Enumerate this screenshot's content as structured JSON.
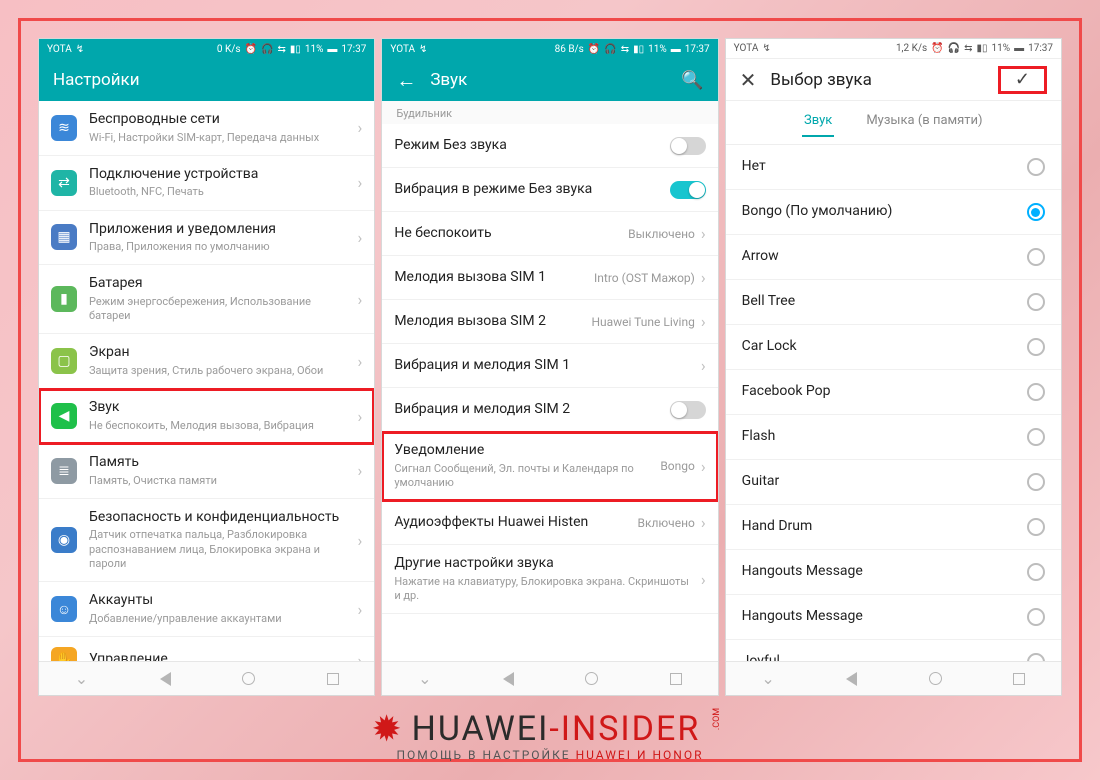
{
  "status": {
    "carrier": "YOTA",
    "p1_speed": "0 K/s",
    "p2_speed": "86 B/s",
    "p3_speed": "1,2 K/s",
    "battery": "11%",
    "time": "17:37"
  },
  "p1": {
    "title": "Настройки",
    "items": [
      {
        "icon": "blue",
        "glyph": "≋",
        "title": "Беспроводные сети",
        "sub": "Wi-Fi, Настройки SIM-карт, Передача данных"
      },
      {
        "icon": "teal",
        "glyph": "⇄",
        "title": "Подключение устройства",
        "sub": "Bluetooth, NFC, Печать"
      },
      {
        "icon": "slate",
        "glyph": "▦",
        "title": "Приложения и уведомления",
        "sub": "Права, Приложения по умолчанию"
      },
      {
        "icon": "green",
        "glyph": "▮",
        "title": "Батарея",
        "sub": "Режим энергосбережения, Использование батареи"
      },
      {
        "icon": "lime",
        "glyph": "▢",
        "title": "Экран",
        "sub": "Защита зрения, Стиль рабочего экрана, Обои"
      },
      {
        "icon": "sound",
        "glyph": "◀︎",
        "title": "Звук",
        "sub": "Не беспокоить, Мелодия вызова, Вибрация",
        "hl": true
      },
      {
        "icon": "gray",
        "glyph": "≣",
        "title": "Память",
        "sub": "Память, Очистка памяти"
      },
      {
        "icon": "shield",
        "glyph": "◉",
        "title": "Безопасность и конфиденциальность",
        "sub": "Датчик отпечатка пальца, Разблокировка распознаванием лица, Блокировка экрана и пароли"
      },
      {
        "icon": "acct",
        "glyph": "☺",
        "title": "Аккаунты",
        "sub": "Добавление/управление аккаунтами"
      },
      {
        "icon": "orange",
        "glyph": "✋",
        "title": "Управление",
        "sub": ""
      }
    ]
  },
  "p2": {
    "title": "Звук",
    "section": "Будильник",
    "items": [
      {
        "title": "Режим Без звука",
        "type": "toggle",
        "on": false
      },
      {
        "title": "Вибрация в режиме Без звука",
        "type": "toggle",
        "on": true
      },
      {
        "title": "Не беспокоить",
        "type": "value",
        "val": "Выключено"
      },
      {
        "title": "Мелодия вызова SIM 1",
        "type": "value",
        "val": "Intro (OST Мажор)"
      },
      {
        "title": "Мелодия вызова SIM 2",
        "type": "value",
        "val": "Huawei Tune Living"
      },
      {
        "title": "Вибрация и мелодия SIM 1",
        "type": "chev"
      },
      {
        "title": "Вибрация и мелодия SIM 2",
        "type": "toggle",
        "on": false
      },
      {
        "title": "Уведомление",
        "sub": "Сигнал Сообщений, Эл. почты и Календаря по умолчанию",
        "type": "value",
        "val": "Bongo",
        "hl": true
      },
      {
        "title": "Аудиоэффекты Huawei Histen",
        "type": "value",
        "val": "Включено"
      },
      {
        "title": "Другие настройки звука",
        "sub": "Нажатие на клавиатуру, Блокировка экрана. Скриншоты и др.",
        "type": "chev"
      }
    ]
  },
  "p3": {
    "title": "Выбор звука",
    "tabs": {
      "a": "Звук",
      "b": "Музыка (в памяти)"
    },
    "items": [
      {
        "name": "Нет",
        "sel": false
      },
      {
        "name": "Bongo (По умолчанию)",
        "sel": true
      },
      {
        "name": "Arrow",
        "sel": false
      },
      {
        "name": "Bell Tree",
        "sel": false
      },
      {
        "name": "Car Lock",
        "sel": false
      },
      {
        "name": "Facebook Pop",
        "sel": false
      },
      {
        "name": "Flash",
        "sel": false
      },
      {
        "name": "Guitar",
        "sel": false
      },
      {
        "name": "Hand Drum",
        "sel": false
      },
      {
        "name": "Hangouts Message",
        "sel": false
      },
      {
        "name": "Hangouts Message",
        "sel": false
      },
      {
        "name": "Joyful",
        "sel": false
      }
    ]
  },
  "footer": {
    "brand_a": "HUAWEI",
    "brand_b": "-INSIDER",
    "com": ".COM",
    "slogan_a": "ПОМОЩЬ В НАСТРОЙКЕ ",
    "slogan_b": "HUAWEI И HONOR"
  }
}
